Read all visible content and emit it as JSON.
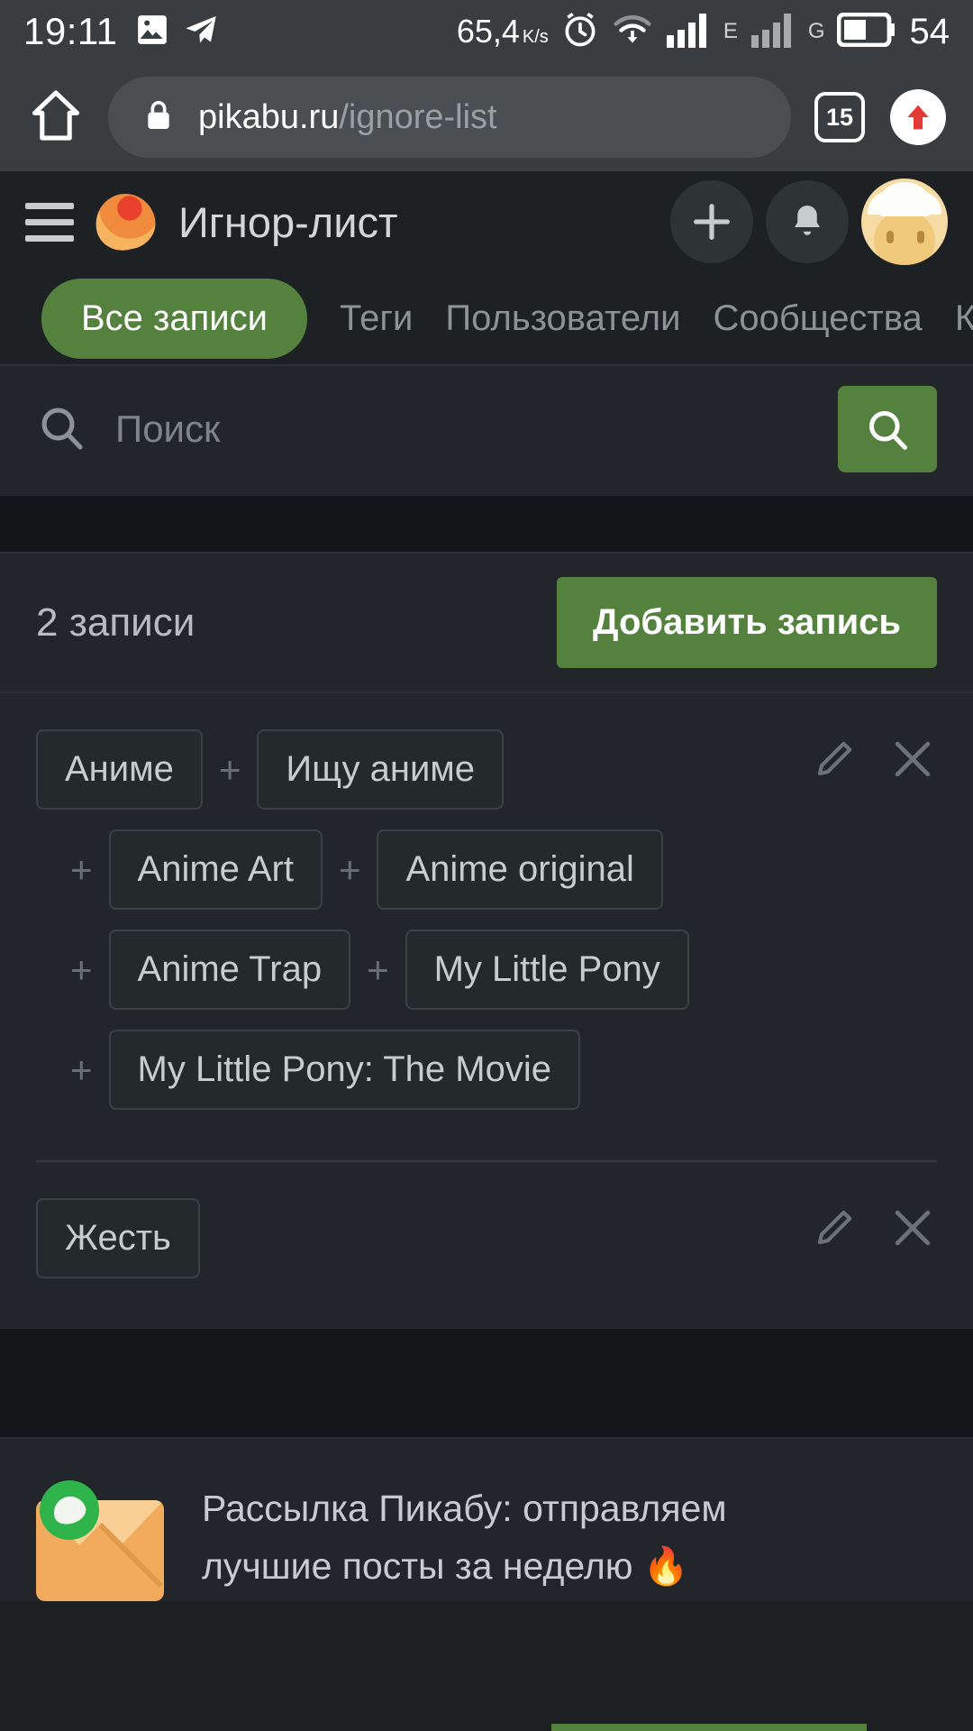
{
  "status_bar": {
    "time": "19:11",
    "left_icons": [
      "image-icon",
      "telegram-icon"
    ],
    "network_speed": "65,4",
    "network_speed_unit": "K/s",
    "right_icons": [
      "alarm-icon",
      "wifi-icon",
      "signal-bars-icon",
      "signal-bars-icon-secondary"
    ],
    "sim1_label": "E",
    "sim2_label": "G",
    "battery_level": "54"
  },
  "browser": {
    "home_icon": "home-icon",
    "lock_icon": "lock-icon",
    "url_domain": "pikabu.ru",
    "url_path": "/ignore-list",
    "tab_count": "15",
    "scroll_top_icon": "arrow-up-icon"
  },
  "app_header": {
    "menu_icon": "hamburger-menu-icon",
    "logo_icon": "pikabu-logo-icon",
    "title": "Игнор-лист",
    "add_icon": "plus-icon",
    "notifications_icon": "bell-icon",
    "avatar_icon": "user-avatar"
  },
  "tabs": [
    {
      "label": "Все записи",
      "active": true
    },
    {
      "label": "Теги",
      "active": false
    },
    {
      "label": "Пользователи",
      "active": false
    },
    {
      "label": "Сообщества",
      "active": false
    },
    {
      "label": "Кл",
      "active": false
    }
  ],
  "search": {
    "icon": "search-icon",
    "placeholder": "Поиск",
    "value": "",
    "button_icon": "search-icon"
  },
  "records": {
    "count_label": "2 записи",
    "add_button_label": "Добавить запись",
    "edit_icon": "pencil-icon",
    "delete_icon": "close-icon",
    "items": [
      {
        "rows": [
          {
            "indent": false,
            "chips": [
              "Аниме",
              "Ищу аниме"
            ],
            "leading_plus": false
          },
          {
            "indent": true,
            "chips": [
              "Anime Art",
              "Anime original"
            ],
            "leading_plus": true
          },
          {
            "indent": true,
            "chips": [
              "Anime Trap",
              "My Little Pony"
            ],
            "leading_plus": true
          },
          {
            "indent": true,
            "chips": [
              "My Little Pony: The Movie"
            ],
            "leading_plus": true
          }
        ]
      },
      {
        "rows": [
          {
            "indent": false,
            "chips": [
              "Жесть"
            ],
            "leading_plus": false
          }
        ]
      }
    ]
  },
  "promo": {
    "icon": "envelope-icon",
    "badge_icon": "whatsapp-icon",
    "line1": "Рассылка Пикабу: отправляем",
    "line2": "лучшие посты за неделю 🔥"
  },
  "colors": {
    "accent_green": "#55813f",
    "page_bg": "#22262a",
    "chrome_bg": "#3a3d40",
    "header_bg": "#1d2124",
    "text_primary": "#c9ccce",
    "text_muted": "#8d9295",
    "red_accent": "#e53935"
  }
}
